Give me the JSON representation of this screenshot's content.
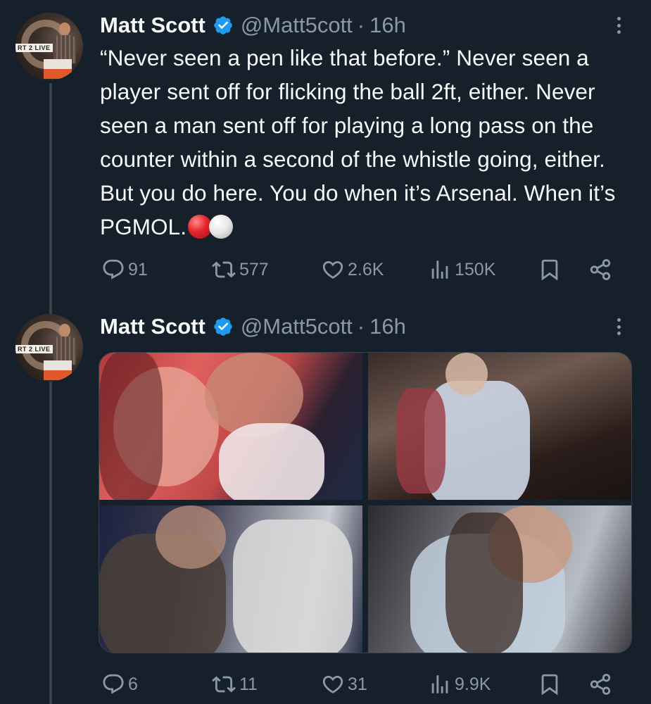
{
  "tweets": [
    {
      "name": "Matt Scott",
      "handle": "@Matt5cott",
      "separator": "·",
      "time": "16h",
      "avatar_badge": "RT 2 LIVE",
      "text": "“Never seen a pen like that before.” Never seen a player sent off for flicking the ball 2ft, either. Never seen a man sent off for playing a long pass on the counter within a second of the whistle going, either. But you do here. You do when it’s Arsenal. When it’s PGMOL.",
      "emojis": [
        "red-circle-emoji",
        "white-circle-emoji"
      ],
      "stats": {
        "replies": "91",
        "reposts": "577",
        "likes": "2.6K",
        "views": "150K"
      }
    },
    {
      "name": "Matt Scott",
      "handle": "@Matt5cott",
      "separator": "·",
      "time": "16h",
      "avatar_badge": "RT 2 LIVE",
      "photos": 4,
      "stats": {
        "replies": "6",
        "reposts": "11",
        "likes": "31",
        "views": "9.9K"
      }
    }
  ],
  "colors": {
    "background": "#15202b",
    "primary_text": "#f7f9f9",
    "secondary_text": "#8b98a5",
    "verified": "#1d9bf0",
    "thread_line": "#38444d"
  },
  "icons": [
    "reply-icon",
    "repost-icon",
    "like-icon",
    "views-icon",
    "bookmark-icon",
    "share-icon",
    "more-icon",
    "verified-badge-icon"
  ]
}
